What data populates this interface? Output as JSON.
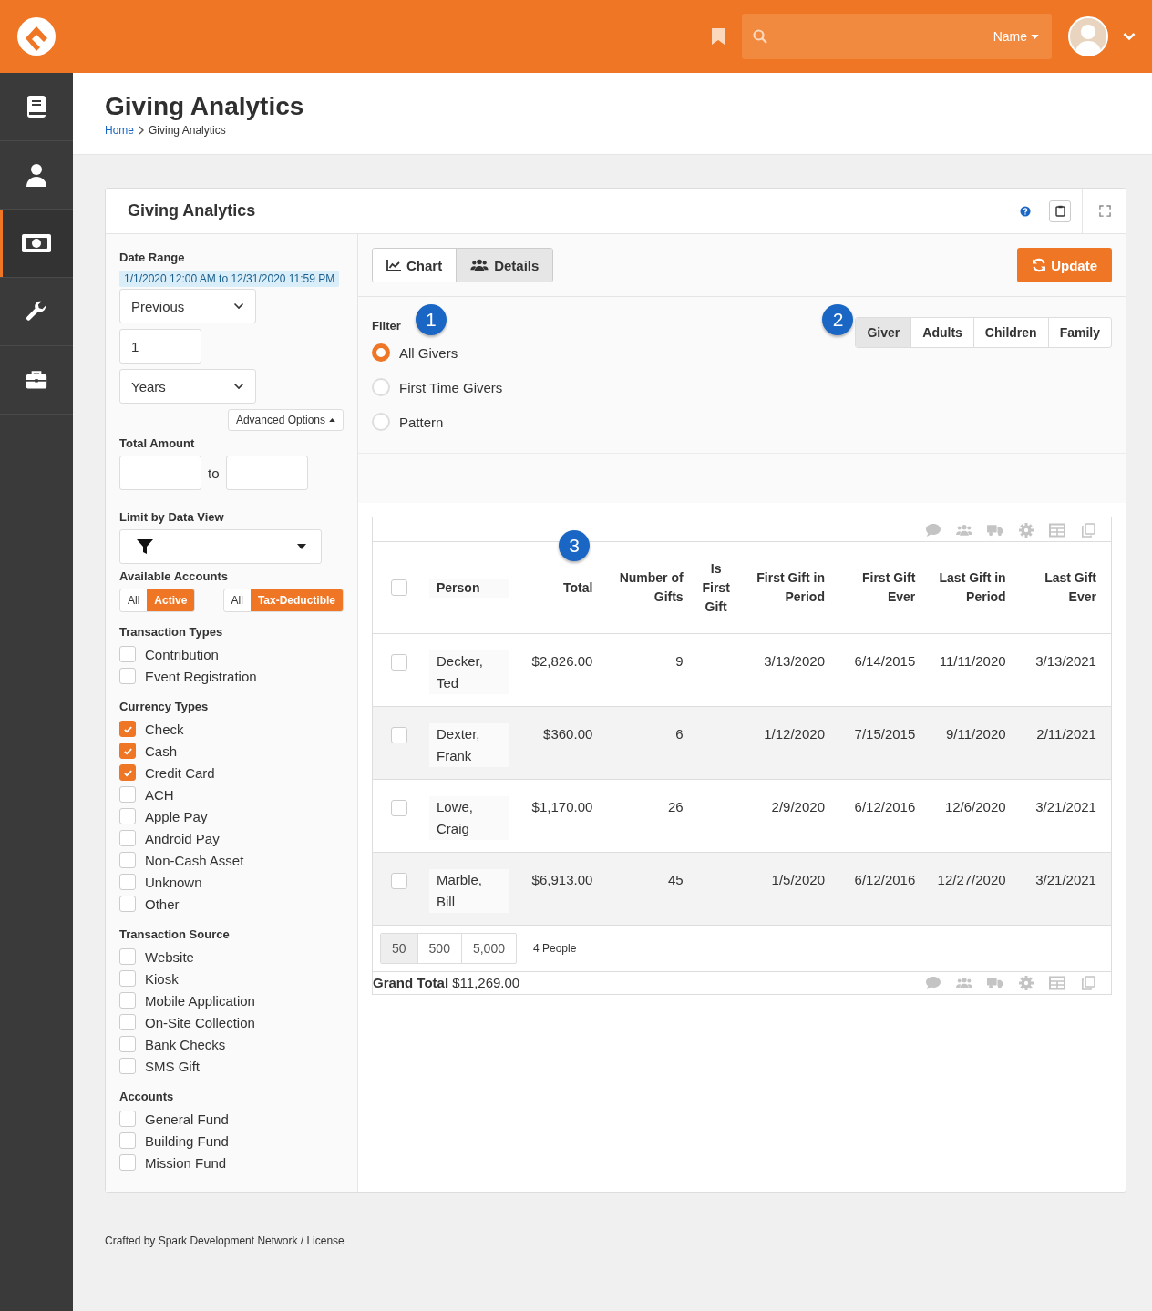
{
  "header": {
    "search_scope": "Name"
  },
  "sidebar": {
    "items": [
      {
        "kind": "book",
        "selected": false
      },
      {
        "kind": "person",
        "selected": false
      },
      {
        "kind": "money",
        "selected": true
      },
      {
        "kind": "wrench",
        "selected": false
      },
      {
        "kind": "briefcase",
        "selected": false
      }
    ]
  },
  "page": {
    "title": "Giving Analytics",
    "breadcrumb": [
      "Home",
      "Giving Analytics"
    ]
  },
  "panel": {
    "title": "Giving Analytics"
  },
  "filters": {
    "date_range": {
      "label": "Date Range",
      "summary": "1/1/2020 12:00 AM to 12/31/2020 11:59 PM",
      "period": "Previous",
      "number": "1",
      "unit": "Years"
    },
    "advanced_options": "Advanced Options",
    "total_amount": {
      "label": "Total Amount",
      "to": "to"
    },
    "data_view": {
      "label": "Limit by Data View"
    },
    "available_accounts": {
      "label": "Available Accounts",
      "toggles": [
        [
          {
            "label": "All",
            "selected": false
          },
          {
            "label": "Active",
            "selected": true
          }
        ],
        [
          {
            "label": "All",
            "selected": false
          },
          {
            "label": "Tax-Deductible",
            "selected": true
          }
        ]
      ]
    },
    "groups": [
      {
        "label": "Transaction Types",
        "items": [
          {
            "label": "Contribution",
            "checked": false
          },
          {
            "label": "Event Registration",
            "checked": false
          }
        ]
      },
      {
        "label": "Currency Types",
        "items": [
          {
            "label": "Check",
            "checked": true
          },
          {
            "label": "Cash",
            "checked": true
          },
          {
            "label": "Credit Card",
            "checked": true
          },
          {
            "label": "ACH",
            "checked": false
          },
          {
            "label": "Apple Pay",
            "checked": false
          },
          {
            "label": "Android Pay",
            "checked": false
          },
          {
            "label": "Non-Cash Asset",
            "checked": false
          },
          {
            "label": "Unknown",
            "checked": false
          },
          {
            "label": "Other",
            "checked": false
          }
        ]
      },
      {
        "label": "Transaction Source",
        "items": [
          {
            "label": "Website",
            "checked": false
          },
          {
            "label": "Kiosk",
            "checked": false
          },
          {
            "label": "Mobile Application",
            "checked": false
          },
          {
            "label": "On-Site Collection",
            "checked": false
          },
          {
            "label": "Bank Checks",
            "checked": false
          },
          {
            "label": "SMS Gift",
            "checked": false
          }
        ]
      },
      {
        "label": "Accounts",
        "items": [
          {
            "label": "General Fund",
            "checked": false
          },
          {
            "label": "Building Fund",
            "checked": false
          },
          {
            "label": "Mission Fund",
            "checked": false
          }
        ]
      }
    ]
  },
  "view_tabs": [
    {
      "kind": "chart",
      "label": "Chart",
      "selected": false
    },
    {
      "kind": "details",
      "label": "Details",
      "selected": true
    }
  ],
  "update_button": "Update",
  "filter": {
    "label": "Filter",
    "options": [
      {
        "label": "All Givers",
        "selected": true
      },
      {
        "label": "First Time Givers",
        "selected": false
      },
      {
        "label": "Pattern",
        "selected": false
      }
    ]
  },
  "group_by": [
    {
      "label": "Giver",
      "selected": true
    },
    {
      "label": "Adults",
      "selected": false
    },
    {
      "label": "Children",
      "selected": false
    },
    {
      "label": "Family",
      "selected": false
    }
  ],
  "markers": [
    "1",
    "2",
    "3"
  ],
  "table": {
    "select_all_checked": false,
    "columns": [
      "Person",
      "Total",
      "Number of Gifts",
      "Is First Gift",
      "First Gift in Period",
      "First Gift Ever",
      "Last Gift in Period",
      "Last Gift Ever"
    ],
    "rows": [
      {
        "checked": false,
        "cells": [
          "Decker, Ted",
          "$2,826.00",
          "9",
          "",
          "3/13/2020",
          "6/14/2015",
          "11/11/2020",
          "3/13/2021"
        ]
      },
      {
        "checked": false,
        "cells": [
          "Dexter, Frank",
          "$360.00",
          "6",
          "",
          "1/12/2020",
          "7/15/2015",
          "9/11/2020",
          "2/11/2021"
        ]
      },
      {
        "checked": false,
        "cells": [
          "Lowe, Craig",
          "$1,170.00",
          "26",
          "",
          "2/9/2020",
          "6/12/2016",
          "12/6/2020",
          "3/21/2021"
        ]
      },
      {
        "checked": false,
        "cells": [
          "Marble, Bill",
          "$6,913.00",
          "45",
          "",
          "1/5/2020",
          "6/12/2016",
          "12/27/2020",
          "3/21/2021"
        ]
      }
    ],
    "page_sizes": [
      {
        "label": "50",
        "selected": true
      },
      {
        "label": "500",
        "selected": false
      },
      {
        "label": "5,000",
        "selected": false
      }
    ],
    "count": "4 People",
    "grand_total": {
      "label": "Grand Total",
      "value": "$11,269.00"
    }
  },
  "footer": "Crafted by Spark Development Network / License"
}
